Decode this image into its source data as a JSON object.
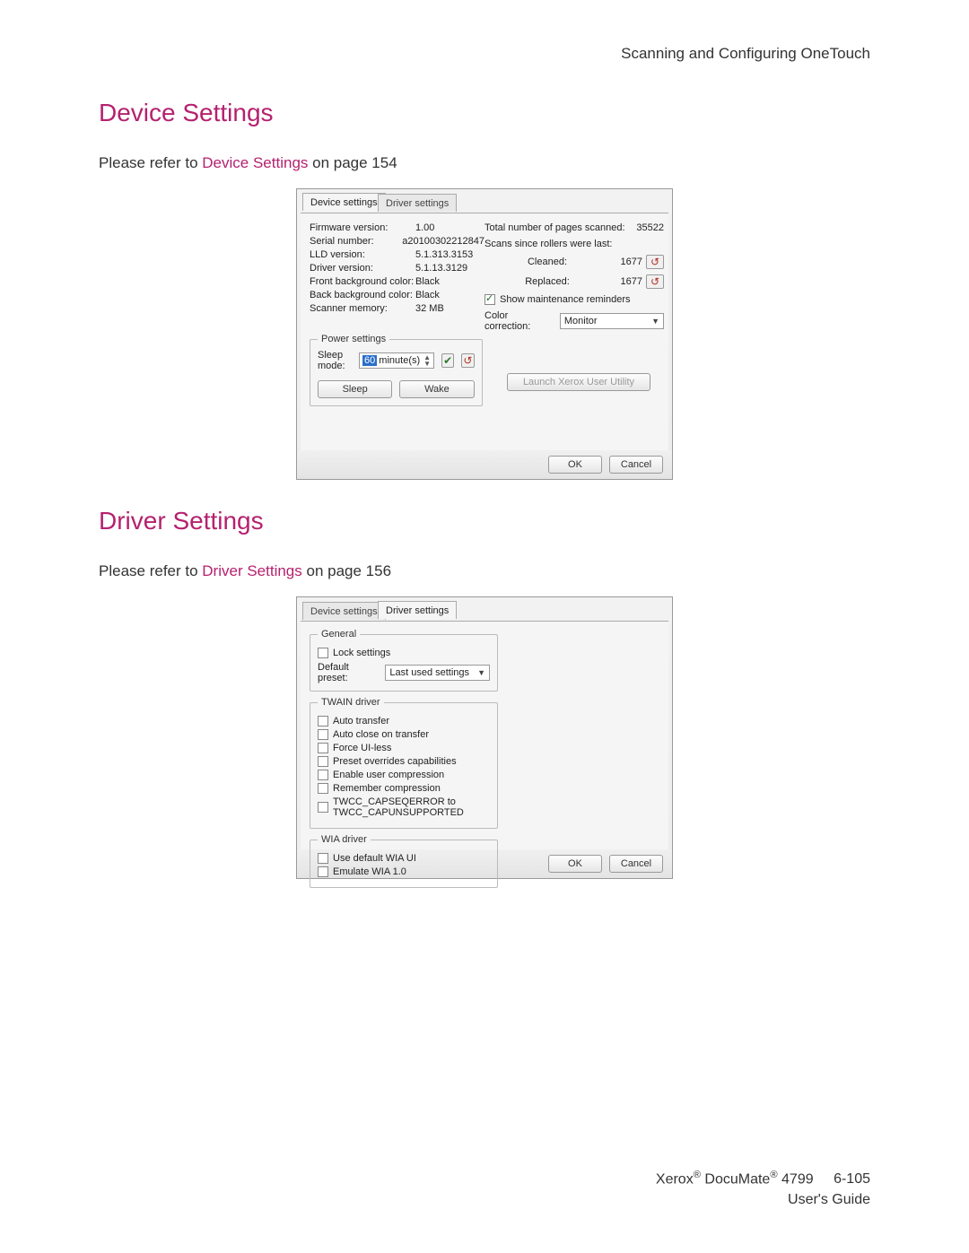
{
  "header": "Scanning and Configuring OneTouch",
  "sections": {
    "device": {
      "title": "Device Settings",
      "refer_prefix": "Please refer to ",
      "refer_link": "Device Settings",
      "refer_suffix": " on page 154"
    },
    "driver": {
      "title": "Driver Settings",
      "refer_prefix": "Please refer to ",
      "refer_link": "Driver Settings",
      "refer_suffix": " on page 156"
    }
  },
  "dialog1": {
    "tabs": {
      "device": "Device settings",
      "driver": "Driver settings"
    },
    "info": {
      "firmware_lbl": "Firmware version:",
      "firmware_val": "1.00",
      "serial_lbl": "Serial number:",
      "serial_val": "a20100302212847",
      "lld_lbl": "LLD version:",
      "lld_val": "5.1.313.3153",
      "drv_lbl": "Driver version:",
      "drv_val": "5.1.13.3129",
      "fbg_lbl": "Front background color:",
      "fbg_val": "Black",
      "bbg_lbl": "Back background color:",
      "bbg_val": "Black",
      "mem_lbl": "Scanner memory:",
      "mem_val": "32 MB"
    },
    "right": {
      "total_lbl": "Total number of pages scanned:",
      "total_val": "35522",
      "since_lbl": "Scans since rollers were last:",
      "cleaned_lbl": "Cleaned:",
      "cleaned_val": "1677",
      "replaced_lbl": "Replaced:",
      "replaced_val": "1677",
      "reminders": "Show maintenance reminders",
      "colorcorr_lbl": "Color correction:",
      "colorcorr_val": "Monitor"
    },
    "power": {
      "legend": "Power settings",
      "sleepmode_lbl": "Sleep mode:",
      "sleepmode_val": "60",
      "sleepmode_unit": "minute(s)",
      "sleep_btn": "Sleep",
      "wake_btn": "Wake"
    },
    "launch_btn": "Launch Xerox User Utility",
    "ok": "OK",
    "cancel": "Cancel"
  },
  "dialog2": {
    "tabs": {
      "device": "Device settings",
      "driver": "Driver settings"
    },
    "general": {
      "legend": "General",
      "lock": "Lock settings",
      "preset_lbl": "Default preset:",
      "preset_val": "Last used settings"
    },
    "twain": {
      "legend": "TWAIN driver",
      "items": [
        "Auto transfer",
        "Auto close on transfer",
        "Force UI-less",
        "Preset overrides capabilities",
        "Enable user compression",
        "Remember compression",
        "TWCC_CAPSEQERROR to TWCC_CAPUNSUPPORTED"
      ]
    },
    "wia": {
      "legend": "WIA driver",
      "items": [
        "Use default WIA UI",
        "Emulate WIA 1.0"
      ]
    },
    "ok": "OK",
    "cancel": "Cancel"
  },
  "footer": {
    "line1_pre": "Xerox",
    "line1_mid": " DocuMate",
    "line1_post": " 4799",
    "page": "6-105",
    "line2": "User's Guide"
  }
}
